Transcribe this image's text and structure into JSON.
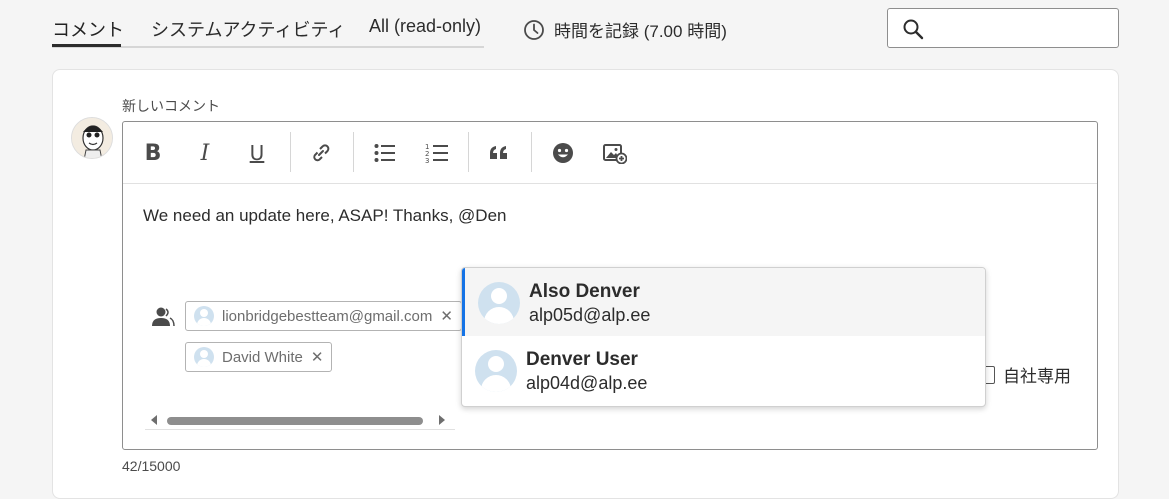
{
  "tabs": [
    {
      "label": "コメント",
      "active": true
    },
    {
      "label": "システムアクティビティ",
      "active": false
    },
    {
      "label": "All (read-only)",
      "active": false
    }
  ],
  "hours": {
    "label": "時間を記録 (7.00 時間)",
    "icon": "clock-icon"
  },
  "search": {
    "placeholder": "",
    "icon": "search-icon"
  },
  "comment": {
    "new_label": "新しいコメント",
    "text": "We need an update here, ASAP! Thanks, @Den",
    "counter": "42/15000"
  },
  "toolbar": {
    "bold": "B",
    "italic": "I",
    "underline": "U",
    "items": [
      "bold",
      "italic",
      "underline",
      "link",
      "bulleted-list",
      "numbered-list",
      "quote",
      "emoji",
      "insert-image"
    ]
  },
  "recipients": [
    {
      "label": "lionbridgebestteam@gmail.com"
    },
    {
      "label": "David White"
    }
  ],
  "internal": {
    "label": "自社専用",
    "checked": false
  },
  "mentions": [
    {
      "name": "Also Denver",
      "email": "alp05d@alp.ee",
      "selected": true
    },
    {
      "name": "Denver User",
      "email": "alp04d@alp.ee",
      "selected": false
    }
  ],
  "colors": {
    "accent": "#1473e6",
    "border": "#8e8e8e",
    "text": "#2c2c2c"
  }
}
